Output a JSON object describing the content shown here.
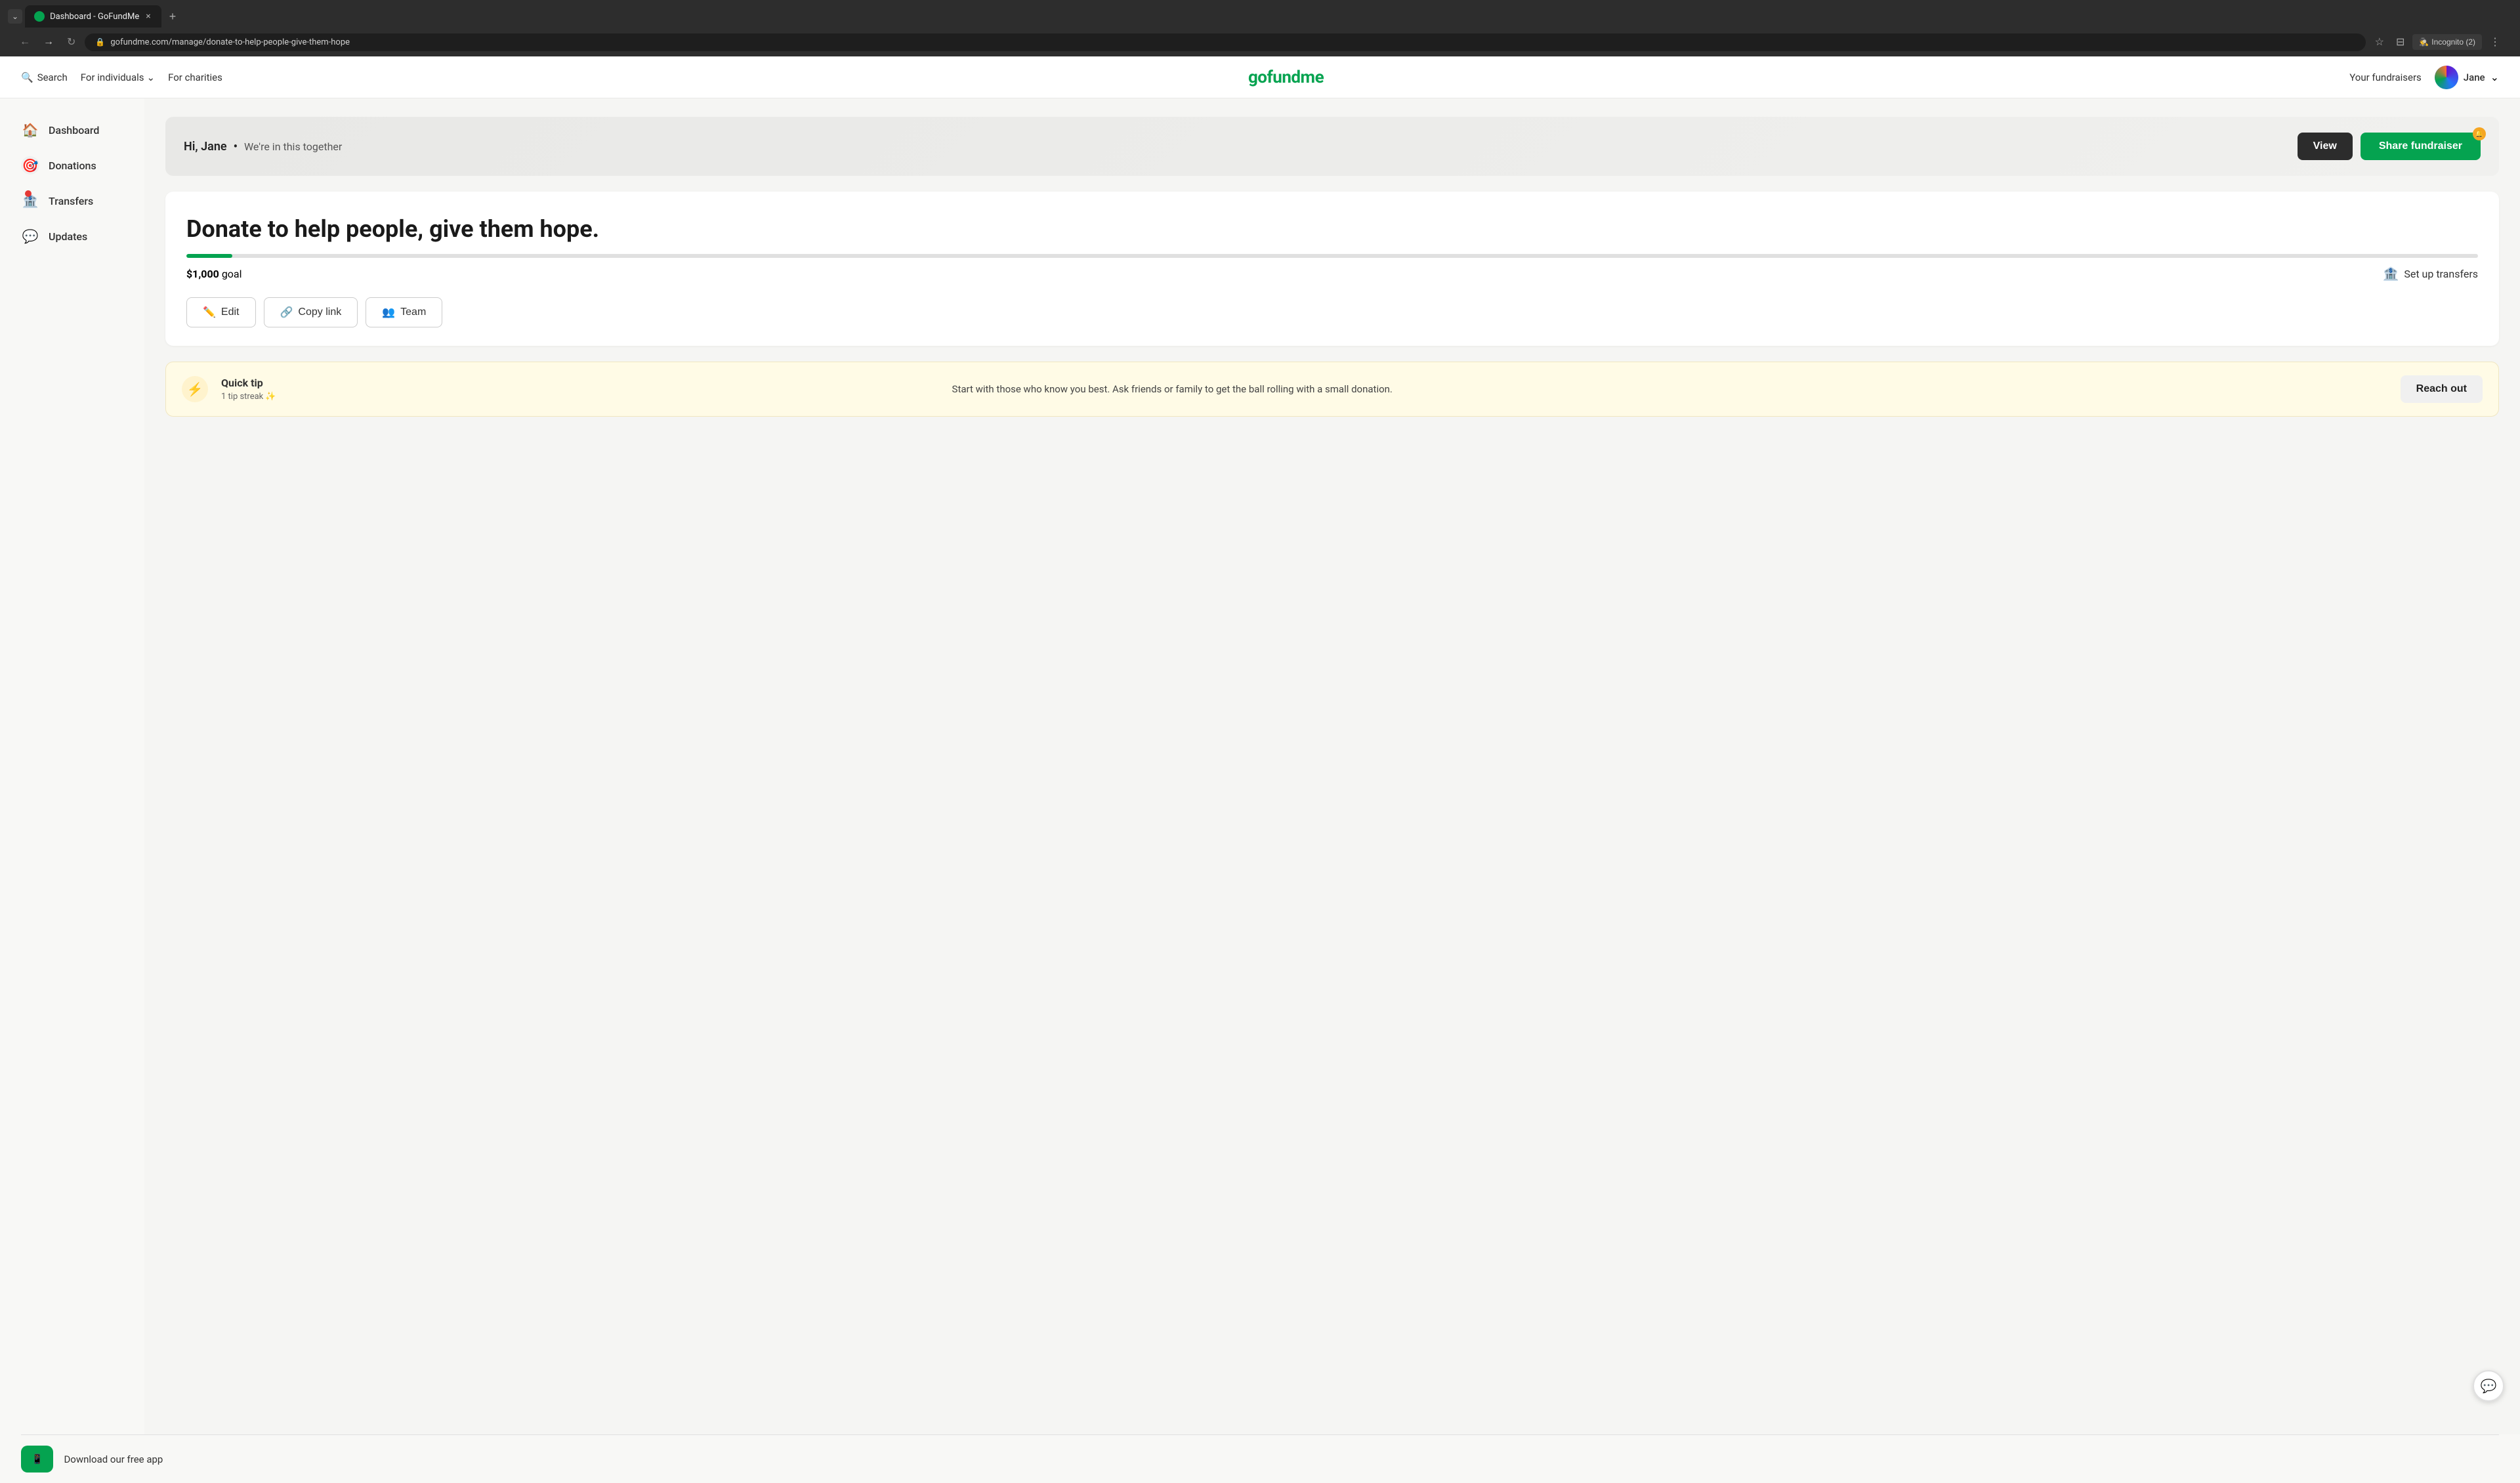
{
  "browser": {
    "tab_title": "Dashboard - GoFundMe",
    "tab_close": "×",
    "new_tab": "+",
    "url": "gofundme.com/manage/donate-to-help-people-give-them-hope",
    "incognito_label": "Incognito (2)"
  },
  "header": {
    "search_label": "Search",
    "for_individuals_label": "For individuals",
    "for_charities_label": "For charities",
    "logo_text": "gofundme",
    "your_fundraisers_label": "Your fundraisers",
    "user_name": "Jane"
  },
  "sidebar": {
    "items": [
      {
        "id": "dashboard",
        "label": "Dashboard",
        "icon": "🏠",
        "active": true
      },
      {
        "id": "donations",
        "label": "Donations",
        "icon": "🎯"
      },
      {
        "id": "transfers",
        "label": "Transfers",
        "icon": "🏦",
        "has_badge": true
      },
      {
        "id": "updates",
        "label": "Updates",
        "icon": "💬"
      }
    ]
  },
  "fundraiser_header": {
    "greeting": "Hi, Jane",
    "separator": "•",
    "subtitle": "We're in this together",
    "view_button": "View",
    "share_button": "Share fundraiser"
  },
  "fundraiser": {
    "title": "Donate to help people, give them hope.",
    "goal_amount": "$1,000",
    "goal_label": "goal",
    "progress_percent": 2,
    "setup_transfers_label": "Set up transfers",
    "actions": [
      {
        "id": "edit",
        "label": "Edit",
        "icon": "✏️"
      },
      {
        "id": "copy-link",
        "label": "Copy link",
        "icon": "🔗"
      },
      {
        "id": "team",
        "label": "Team",
        "icon": "👥"
      }
    ]
  },
  "quick_tip": {
    "icon": "⚡",
    "title": "Quick tip",
    "streak_label": "1 tip streak",
    "streak_icon": "✨",
    "text": "Start with those who know you best. Ask friends or family to get the ball rolling with a small donation.",
    "reach_out_label": "Reach out"
  },
  "footer": {
    "download_app_label": "Download our free app",
    "app_icon": "📱"
  },
  "chat_button": {
    "icon": "💬"
  }
}
